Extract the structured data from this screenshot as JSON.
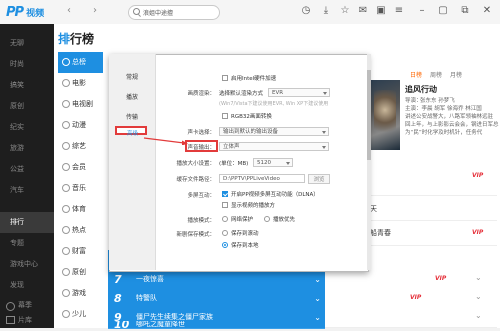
{
  "app": {
    "logo_pp": "PP",
    "logo_text": "视频"
  },
  "search": {
    "value": "浪姐中途擅"
  },
  "sidebar": {
    "items": [
      {
        "label": "无聊",
        "active": false
      },
      {
        "label": "时尚",
        "active": false
      },
      {
        "label": "搞笑",
        "active": false
      },
      {
        "label": "原创",
        "active": false
      },
      {
        "label": "纪实",
        "active": false
      },
      {
        "label": "旅游",
        "active": false
      },
      {
        "label": "公益",
        "active": false
      },
      {
        "label": "汽车",
        "active": false
      },
      {
        "label": "排行",
        "active": true
      },
      {
        "label": "专题",
        "active": false
      },
      {
        "label": "游戏中心",
        "active": false
      },
      {
        "label": "发现",
        "active": false
      },
      {
        "label": "幕季",
        "active": false
      },
      {
        "label": "片库",
        "active": false
      }
    ]
  },
  "page": {
    "title_hl": "排",
    "title_rest": "行榜"
  },
  "categories": [
    {
      "label": "总榜",
      "active": true
    },
    {
      "label": "电影"
    },
    {
      "label": "电视剧"
    },
    {
      "label": "动漫"
    },
    {
      "label": "综艺"
    },
    {
      "label": "会员"
    },
    {
      "label": "音乐"
    },
    {
      "label": "体育"
    },
    {
      "label": "热点"
    },
    {
      "label": "财富"
    },
    {
      "label": "原创"
    },
    {
      "label": "游戏"
    },
    {
      "label": "少儿"
    },
    {
      "label": "纪实"
    }
  ],
  "rank_list": [
    {
      "num": "7",
      "title": "一夜惊喜"
    },
    {
      "num": "8",
      "title": "特警队"
    },
    {
      "num": "9",
      "title": "僵尸先生续集之僵尸家族"
    },
    {
      "num": "10",
      "title": "哪吒之魔童降世"
    }
  ],
  "right_panel": {
    "filters": [
      "日榜",
      "周榜",
      "月榜"
    ],
    "show_title": "追风行动",
    "lines": [
      "导演：",
      "张东东 孙梦飞",
      "主演：李晨 胡军 徐海乔 林江国",
      "讲述公安战警大，八路军领袖林远驻",
      "回上年，与上影影云会会，钢进日军总",
      "为“民”时化学及时机针，任务代"
    ],
    "vip": "VIP",
    "frags": [
      "天",
      "船青春"
    ]
  },
  "dialog": {
    "tabs": [
      "常规",
      "播放",
      "传输",
      "高级"
    ],
    "selected_tab": "高级",
    "rows": {
      "enable_hw": "启用Intel硬件加速",
      "render_label": "画质渲染：",
      "render_choice": "选择默认渲染方式",
      "render_value": "EVR",
      "render_hint": "(Win7/Vista下建议使用EVR, Win XP下建议使用",
      "rgb": "RGB32画面转换",
      "sound_card_label": "声卡选择：",
      "sound_card_value": "输出到默认的输出设备",
      "sound_out_label": "声音输出：",
      "sound_out_value": "立体声",
      "cache_label": "播放大小设置：",
      "cache_unit": "(单位：MB)",
      "cache_value": "5120",
      "path_label": "缓存文件路径：",
      "path_value": "D:\\PPTV\\PPLiveVideo",
      "browse": "浏览",
      "multi_label": "多屏互动：",
      "dlna": "开启PP视频多屏互动功能（DLNA）",
      "show_device": "显示视频的播放方",
      "mode_label": "播放模式：",
      "mode_a": "网络保护",
      "mode_b": "播放优先",
      "newplay_label": "新剧保存模式：",
      "save_a": "保存到滚动",
      "save_b": "保存到本地"
    }
  },
  "colors": {
    "accent": "#1e8fe1",
    "highlight": "#e23b3b"
  }
}
